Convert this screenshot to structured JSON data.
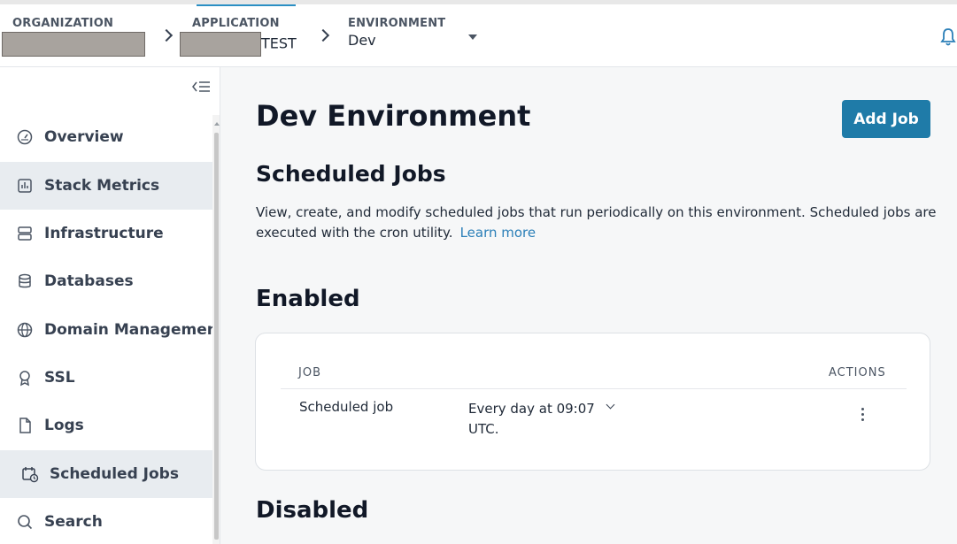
{
  "header": {
    "organization": {
      "label": "ORGANIZATION",
      "value": ""
    },
    "application": {
      "label": "APPLICATION",
      "value": "TEST"
    },
    "environment": {
      "label": "ENVIRONMENT",
      "value": "Dev"
    }
  },
  "sidebar": {
    "items": [
      {
        "label": "Overview",
        "icon": "gauge-icon"
      },
      {
        "label": "Stack Metrics",
        "icon": "chart-icon"
      },
      {
        "label": "Infrastructure",
        "icon": "server-icon"
      },
      {
        "label": "Databases",
        "icon": "database-icon"
      },
      {
        "label": "Domain Managemen",
        "icon": "globe-icon"
      },
      {
        "label": "SSL",
        "icon": "badge-icon"
      },
      {
        "label": "Logs",
        "icon": "file-icon"
      },
      {
        "label": "Scheduled Jobs",
        "icon": "calendar-clock-icon"
      },
      {
        "label": "Search",
        "icon": "search-icon"
      }
    ]
  },
  "main": {
    "title": "Dev Environment",
    "add_job_label": "Add Job",
    "section_title": "Scheduled Jobs",
    "description": "View, create, and modify scheduled jobs that run periodically on this environment. Scheduled jobs are executed with the cron utility.",
    "learn_more": "Learn more",
    "enabled_title": "Enabled",
    "table": {
      "col_job": "JOB",
      "col_actions": "ACTIONS",
      "rows": [
        {
          "name": "Scheduled job",
          "schedule": "Every day at 09:07 UTC."
        }
      ]
    },
    "disabled_title": "Disabled"
  },
  "colors": {
    "accent": "#1f7ba8",
    "link": "#2b7fb8",
    "active_nav_bg": "#e8ecf0"
  }
}
